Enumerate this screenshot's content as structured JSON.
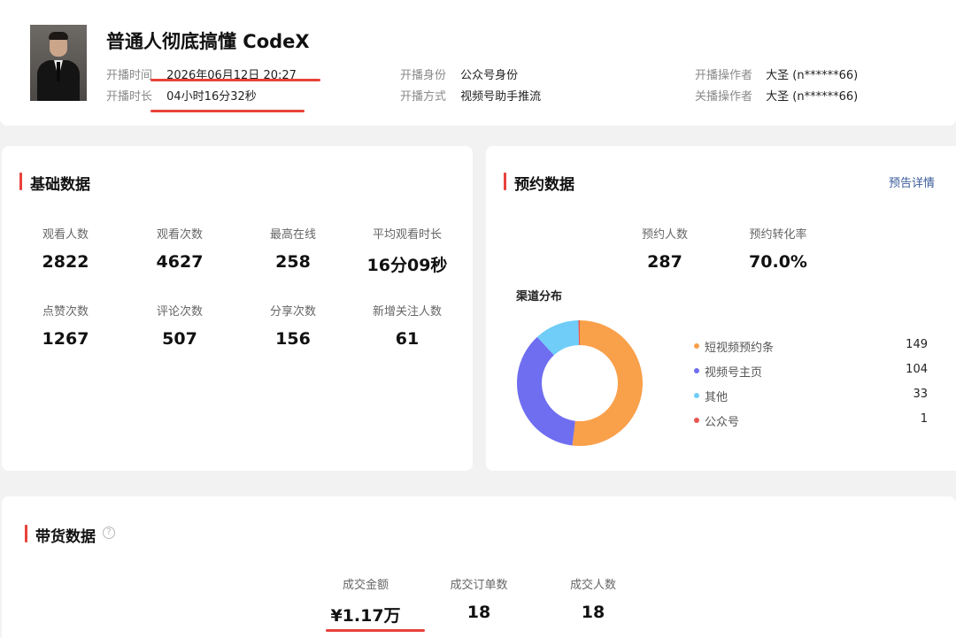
{
  "header": {
    "title": "普通人彻底搞懂 CodeX",
    "start_time_label": "开播时间",
    "start_time_value": "2026年06月12日 20:27",
    "duration_label": "开播时长",
    "duration_value": "04小时16分32秒",
    "identity_label": "开播身份",
    "identity_value": "公众号身份",
    "method_label": "开播方式",
    "method_value": "视频号助手推流",
    "start_operator_label": "开播操作者",
    "start_operator_value": "大圣 (n******66)",
    "end_operator_label": "关播操作者",
    "end_operator_value": "大圣 (n******66)"
  },
  "basic": {
    "title": "基础数据",
    "stats": [
      {
        "label": "观看人数",
        "value": "2822"
      },
      {
        "label": "观看次数",
        "value": "4627"
      },
      {
        "label": "最高在线",
        "value": "258"
      },
      {
        "label": "平均观看时长",
        "value": "16分09秒"
      },
      {
        "label": "点赞次数",
        "value": "1267"
      },
      {
        "label": "评论次数",
        "value": "507"
      },
      {
        "label": "分享次数",
        "value": "156"
      },
      {
        "label": "新增关注人数",
        "value": "61"
      }
    ]
  },
  "reserve": {
    "title": "预约数据",
    "detail_link": "预告详情",
    "stats": [
      {
        "label": "预约人数",
        "value": "287"
      },
      {
        "label": "预约转化率",
        "value": "70.0%"
      }
    ],
    "channel_title": "渠道分布"
  },
  "chart_data": {
    "type": "pie",
    "donut": true,
    "title": "",
    "categories": [
      "短视频预约条",
      "视频号主页",
      "其他",
      "公众号"
    ],
    "values": [
      149,
      104,
      33,
      1
    ],
    "colors": [
      "#f9a04a",
      "#6f6ef0",
      "#6fcdf8",
      "#e8544e"
    ],
    "legend_position": "right"
  },
  "sales": {
    "title": "带货数据",
    "help_icon": "question-circle-icon",
    "stats": [
      {
        "label": "成交金额",
        "value": "¥1.17万"
      },
      {
        "label": "成交订单数",
        "value": "18"
      },
      {
        "label": "成交人数",
        "value": "18"
      }
    ]
  },
  "colors": {
    "accent_red": "#e8423b",
    "link_blue": "#3a5a9a"
  }
}
